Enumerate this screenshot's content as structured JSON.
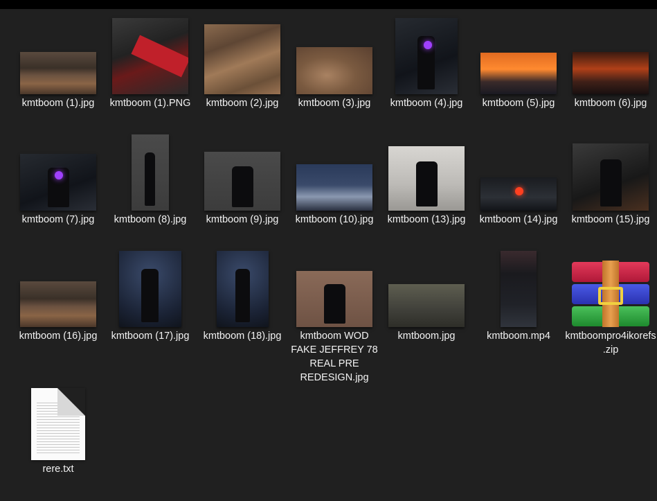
{
  "files": [
    {
      "name": "kmtboom (1).jpg",
      "icon": "image-thumbnail",
      "kind": "desert"
    },
    {
      "name": "kmtboom (1).PNG",
      "icon": "image-thumbnail",
      "kind": "red"
    },
    {
      "name": "kmtboom (2).jpg",
      "icon": "image-thumbnail",
      "kind": "sand"
    },
    {
      "name": "kmtboom (3).jpg",
      "icon": "image-thumbnail",
      "kind": "sand2"
    },
    {
      "name": "kmtboom (4).jpg",
      "icon": "image-thumbnail",
      "kind": "dark"
    },
    {
      "name": "kmtboom (5).jpg",
      "icon": "image-thumbnail",
      "kind": "sunset"
    },
    {
      "name": "kmtboom (6).jpg",
      "icon": "image-thumbnail",
      "kind": "fire"
    },
    {
      "name": "kmtboom (7).jpg",
      "icon": "image-thumbnail",
      "kind": "dark"
    },
    {
      "name": "kmtboom (8).jpg",
      "icon": "image-thumbnail",
      "kind": "gray"
    },
    {
      "name": "kmtboom (9).jpg",
      "icon": "image-thumbnail",
      "kind": "gray"
    },
    {
      "name": "kmtboom (10).jpg",
      "icon": "image-thumbnail",
      "kind": "snow"
    },
    {
      "name": "kmtboom (13).jpg",
      "icon": "image-thumbnail",
      "kind": "light"
    },
    {
      "name": "kmtboom (14).jpg",
      "icon": "image-thumbnail",
      "kind": "industrial"
    },
    {
      "name": "kmtboom (15).jpg",
      "icon": "image-thumbnail",
      "kind": "machine"
    },
    {
      "name": "kmtboom (16).jpg",
      "icon": "image-thumbnail",
      "kind": "desert"
    },
    {
      "name": "kmtboom (17).jpg",
      "icon": "image-thumbnail",
      "kind": "stage"
    },
    {
      "name": "kmtboom (18).jpg",
      "icon": "image-thumbnail",
      "kind": "stage"
    },
    {
      "name": "kmtboom WOD FAKE JEFFREY 78 REAL PRE REDESIGN.jpg",
      "icon": "image-thumbnail",
      "kind": "brick"
    },
    {
      "name": "kmtboom.jpg",
      "icon": "image-thumbnail",
      "kind": "ruins"
    },
    {
      "name": "kmtboom.mp4",
      "icon": "video-thumbnail",
      "kind": "phone"
    },
    {
      "name": "kmtboompro4ikorefs.zip",
      "icon": "winrar-archive-icon",
      "kind": "zip"
    },
    {
      "name": "rere.txt",
      "icon": "text-file-icon",
      "kind": "txt"
    }
  ],
  "colors": {
    "background": "#202020",
    "top_bar": "#000000",
    "label_text": "#f2f2f2"
  }
}
